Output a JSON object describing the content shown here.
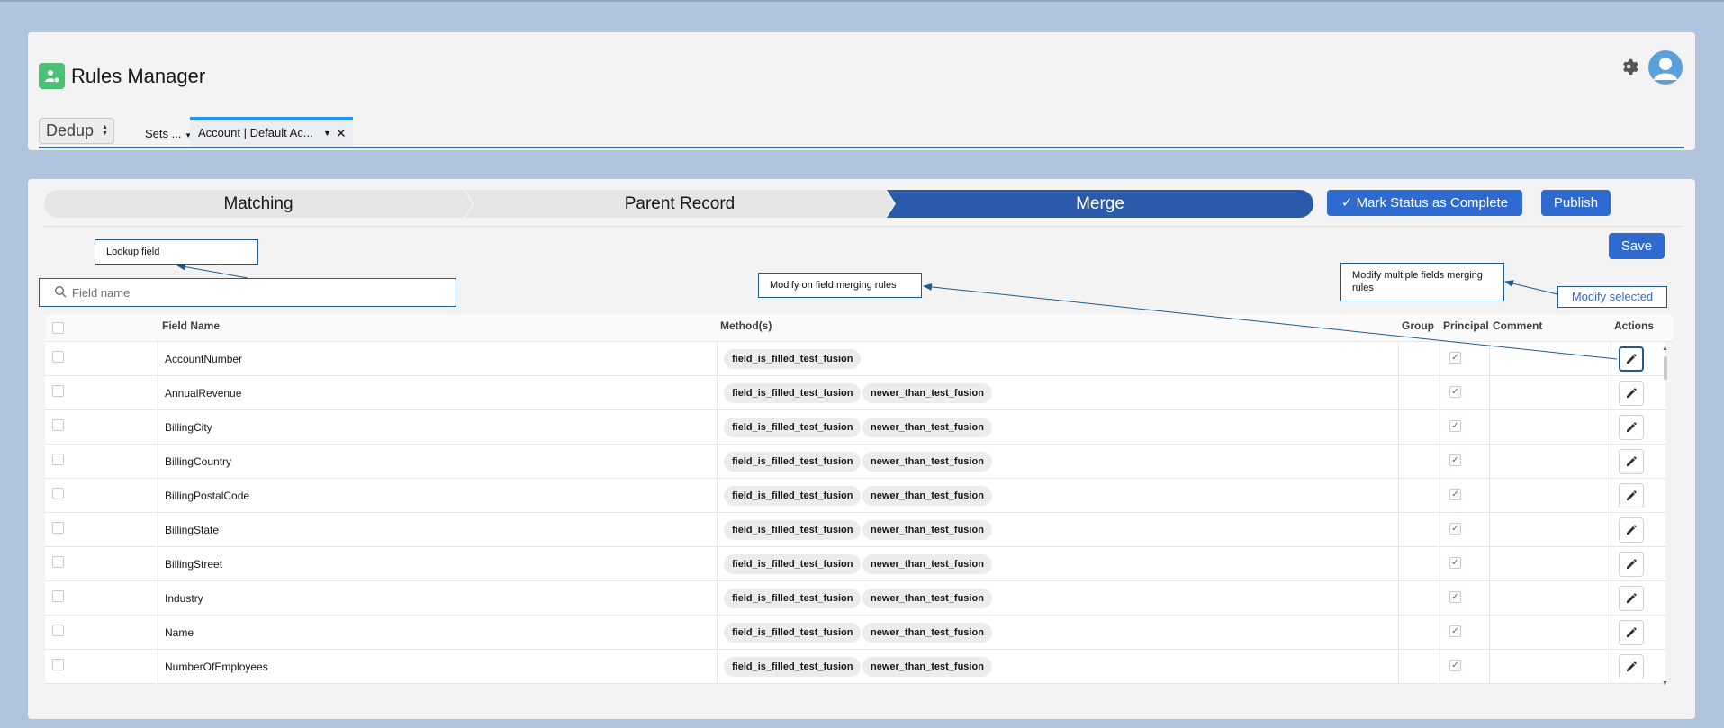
{
  "app": {
    "title": "Rules Manager",
    "icon": "rules-manager-app-icon",
    "brand_color": "#4bc076"
  },
  "header": {
    "settings_icon": "gear-icon",
    "avatar_icon": "user-avatar-icon",
    "mode_select": {
      "value": "Dedup"
    },
    "tabs": [
      {
        "label": "Sets ...",
        "has_dropdown": true
      },
      {
        "label": "Account | Default Ac...",
        "has_dropdown": true,
        "closable": true,
        "active": true
      }
    ]
  },
  "path": {
    "steps": [
      {
        "label": "Matching",
        "active": false
      },
      {
        "label": "Parent Record",
        "active": false
      },
      {
        "label": "Merge",
        "active": true
      }
    ],
    "mark_complete_label": "Mark Status as Complete",
    "publish_label": "Publish"
  },
  "toolbar": {
    "save_label": "Save",
    "modify_selected_label": "Modify selected"
  },
  "search": {
    "placeholder": "Field name",
    "value": ""
  },
  "callouts": {
    "lookup": "Lookup field",
    "modify_one": "Modify on field merging rules",
    "modify_multi": "Modify multiple fields merging rules"
  },
  "table": {
    "headers": {
      "field_name": "Field Name",
      "methods": "Method(s)",
      "group": "Group",
      "principal": "Principal",
      "comment": "Comment",
      "actions": "Actions"
    },
    "rows": [
      {
        "field": "AccountNumber",
        "methods": [
          "field_is_filled_test_fusion"
        ],
        "principal": true
      },
      {
        "field": "AnnualRevenue",
        "methods": [
          "field_is_filled_test_fusion",
          "newer_than_test_fusion"
        ],
        "principal": true
      },
      {
        "field": "BillingCity",
        "methods": [
          "field_is_filled_test_fusion",
          "newer_than_test_fusion"
        ],
        "principal": true
      },
      {
        "field": "BillingCountry",
        "methods": [
          "field_is_filled_test_fusion",
          "newer_than_test_fusion"
        ],
        "principal": true
      },
      {
        "field": "BillingPostalCode",
        "methods": [
          "field_is_filled_test_fusion",
          "newer_than_test_fusion"
        ],
        "principal": true
      },
      {
        "field": "BillingState",
        "methods": [
          "field_is_filled_test_fusion",
          "newer_than_test_fusion"
        ],
        "principal": true
      },
      {
        "field": "BillingStreet",
        "methods": [
          "field_is_filled_test_fusion",
          "newer_than_test_fusion"
        ],
        "principal": true
      },
      {
        "field": "Industry",
        "methods": [
          "field_is_filled_test_fusion",
          "newer_than_test_fusion"
        ],
        "principal": true
      },
      {
        "field": "Name",
        "methods": [
          "field_is_filled_test_fusion",
          "newer_than_test_fusion"
        ],
        "principal": true
      },
      {
        "field": "NumberOfEmployees",
        "methods": [
          "field_is_filled_test_fusion",
          "newer_than_test_fusion"
        ],
        "principal": true
      }
    ]
  },
  "colors": {
    "primary": "#2f6ad0",
    "path_active": "#2b5aab",
    "background": "#b0c4de",
    "callout_border": "#1f5a8a"
  }
}
